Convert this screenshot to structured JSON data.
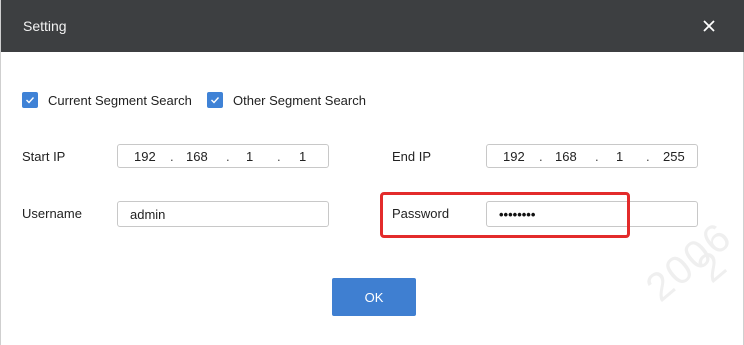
{
  "dialog": {
    "title": "Setting"
  },
  "checkboxes": [
    {
      "label": "Current Segment Search",
      "checked": true
    },
    {
      "label": "Other Segment Search",
      "checked": true
    }
  ],
  "start_ip": {
    "label": "Start IP",
    "octets": [
      "192",
      "168",
      "1",
      "1"
    ]
  },
  "end_ip": {
    "label": "End IP",
    "octets": [
      "192",
      "168",
      "1",
      "255"
    ]
  },
  "username": {
    "label": "Username",
    "value": "admin"
  },
  "password": {
    "label": "Password",
    "value": "••••••••"
  },
  "ok_button": {
    "label": "OK"
  },
  "watermark": {
    "text": "2006",
    "text2": "2"
  },
  "colors": {
    "titlebar": "#3d3f41",
    "checkbox_accent": "#3f82d6",
    "button": "#3f7fd1",
    "highlight": "#e32b2b"
  }
}
